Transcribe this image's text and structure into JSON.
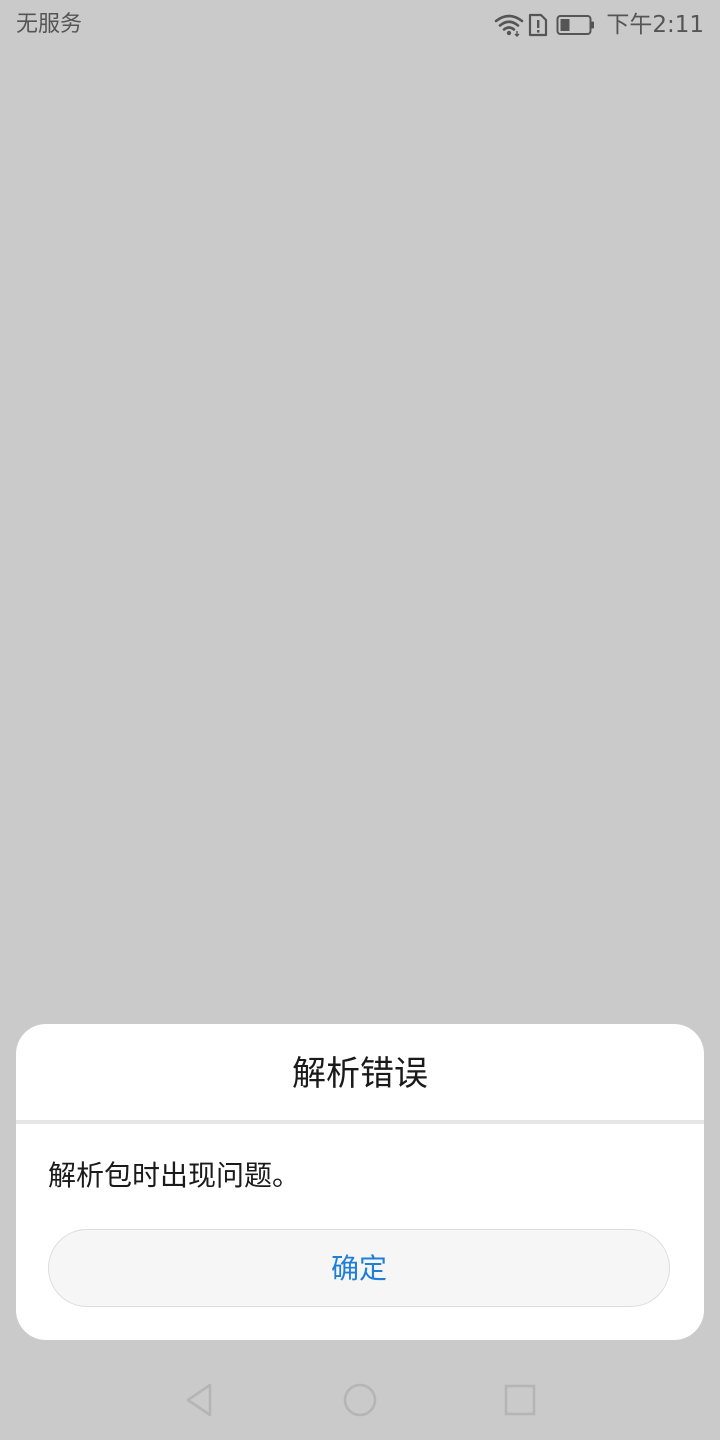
{
  "status_bar": {
    "carrier": "无服务",
    "time": "下午2:11",
    "icons": [
      "wifi-icon",
      "sim-alert-icon",
      "battery-icon"
    ],
    "battery_level": 0.3
  },
  "dialog": {
    "title": "解析错误",
    "message": "解析包时出现问题。",
    "confirm_label": "确定"
  },
  "navigation": {
    "icons": [
      "back-icon",
      "home-icon",
      "recent-apps-icon"
    ]
  },
  "colors": {
    "background": "#cacaca",
    "dialog_background": "#ffffff",
    "accent": "#1f7fd6",
    "status_text": "#555555"
  }
}
